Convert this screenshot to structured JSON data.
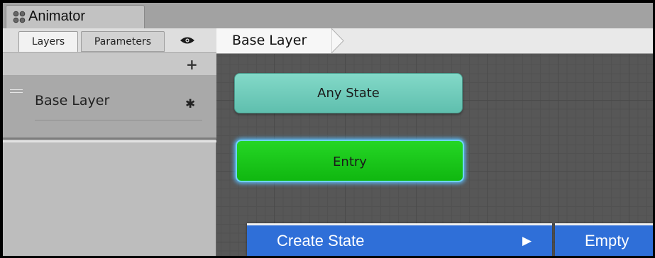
{
  "window": {
    "title": "Animator",
    "icon": "animator-icon"
  },
  "left_panel": {
    "tabs": [
      {
        "label": "Layers",
        "active": true
      },
      {
        "label": "Parameters",
        "active": false
      }
    ],
    "visibility_icon": "eye-icon",
    "add_icon": "plus-icon",
    "add_symbol": "+",
    "layers": [
      {
        "name": "Base Layer",
        "settings_icon": "gear-icon",
        "settings_symbol": "✱"
      }
    ]
  },
  "graph": {
    "breadcrumb": "Base Layer",
    "states": [
      {
        "label": "Any State",
        "color": "#6fcbb9"
      },
      {
        "label": "Entry",
        "color": "#1cc71c"
      }
    ]
  },
  "context_menu": {
    "items": [
      {
        "label": "Create State",
        "arrow": "▶",
        "highlighted": true
      }
    ],
    "submenu": [
      {
        "label": "Empty",
        "highlighted": true
      }
    ],
    "highlight_color": "#2f6fd8"
  }
}
